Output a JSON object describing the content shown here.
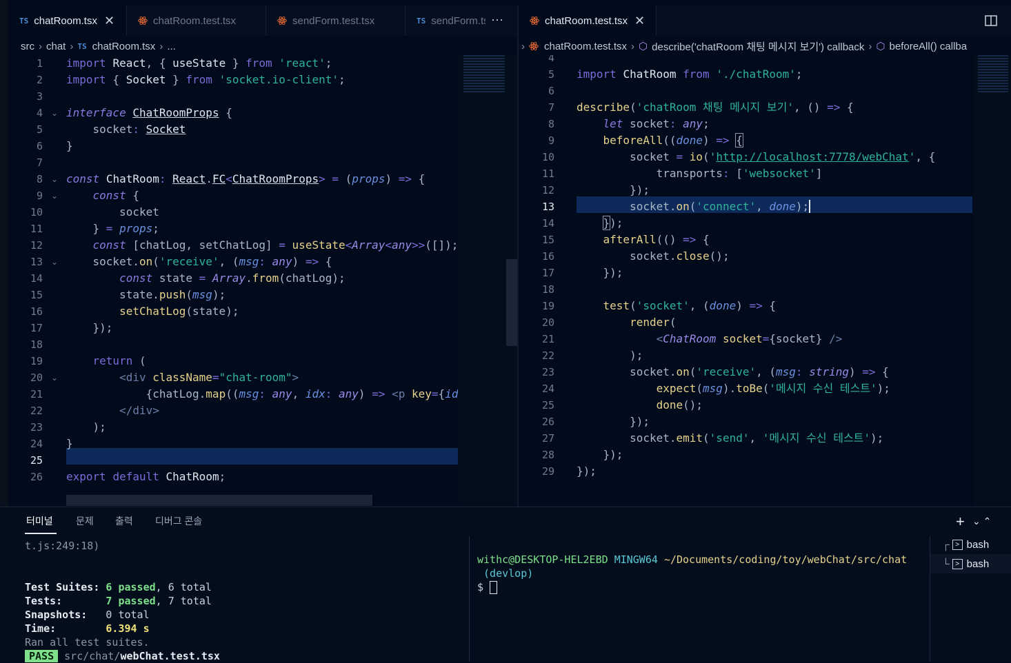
{
  "left": {
    "tabs": [
      {
        "badge": "TS",
        "label": "chatRoom.tsx",
        "active": true
      },
      {
        "badge": "react",
        "label": "chatRoom.test.tsx",
        "active": false
      },
      {
        "badge": "react",
        "label": "sendForm.test.tsx",
        "active": false
      },
      {
        "badge": "TS",
        "label": "sendForm.ts",
        "active": false
      }
    ],
    "more": "···",
    "breadcrumb": [
      "src",
      "chat",
      "chatRoom.tsx",
      "..."
    ],
    "ts_badge": "TS",
    "current_line": 25
  },
  "right": {
    "tab": {
      "label": "chatRoom.test.tsx"
    },
    "breadcrumb": [
      "chatRoom.test.tsx",
      "describe('chatRoom 채팅 메시지 보기') callback",
      "beforeAll() callba"
    ],
    "current_line": 13
  },
  "panel": {
    "tabs": [
      "터미널",
      "문제",
      "출력",
      "디버그 콘솔"
    ],
    "terminal_left": {
      "top_line": "t.js:249:18)",
      "suites_label": "Test Suites:",
      "suites_passed": "6 passed",
      "suites_total": ", 6 total",
      "tests_label": "Tests:",
      "tests_passed": "7 passed",
      "tests_total": ", 7 total",
      "snap_label": "Snapshots:",
      "snap_value": "0 total",
      "time_label": "Time:",
      "time_value": "6.394 s",
      "ran": "Ran all test suites.",
      "pass_badge": "PASS",
      "pass_path_dim": "src/chat/",
      "pass_path_file": "webChat.test.tsx"
    },
    "terminal_right": {
      "user": "withc@DESKTOP-HEL2EBD",
      "env": "MINGW64",
      "path": "~/Documents/coding/toy/webChat/src/chat",
      "branch": "(devlop)",
      "prompt": "$"
    },
    "terminals": [
      "bash",
      "bash"
    ],
    "plus": "+",
    "chevrons": "⌄  ⌃"
  }
}
